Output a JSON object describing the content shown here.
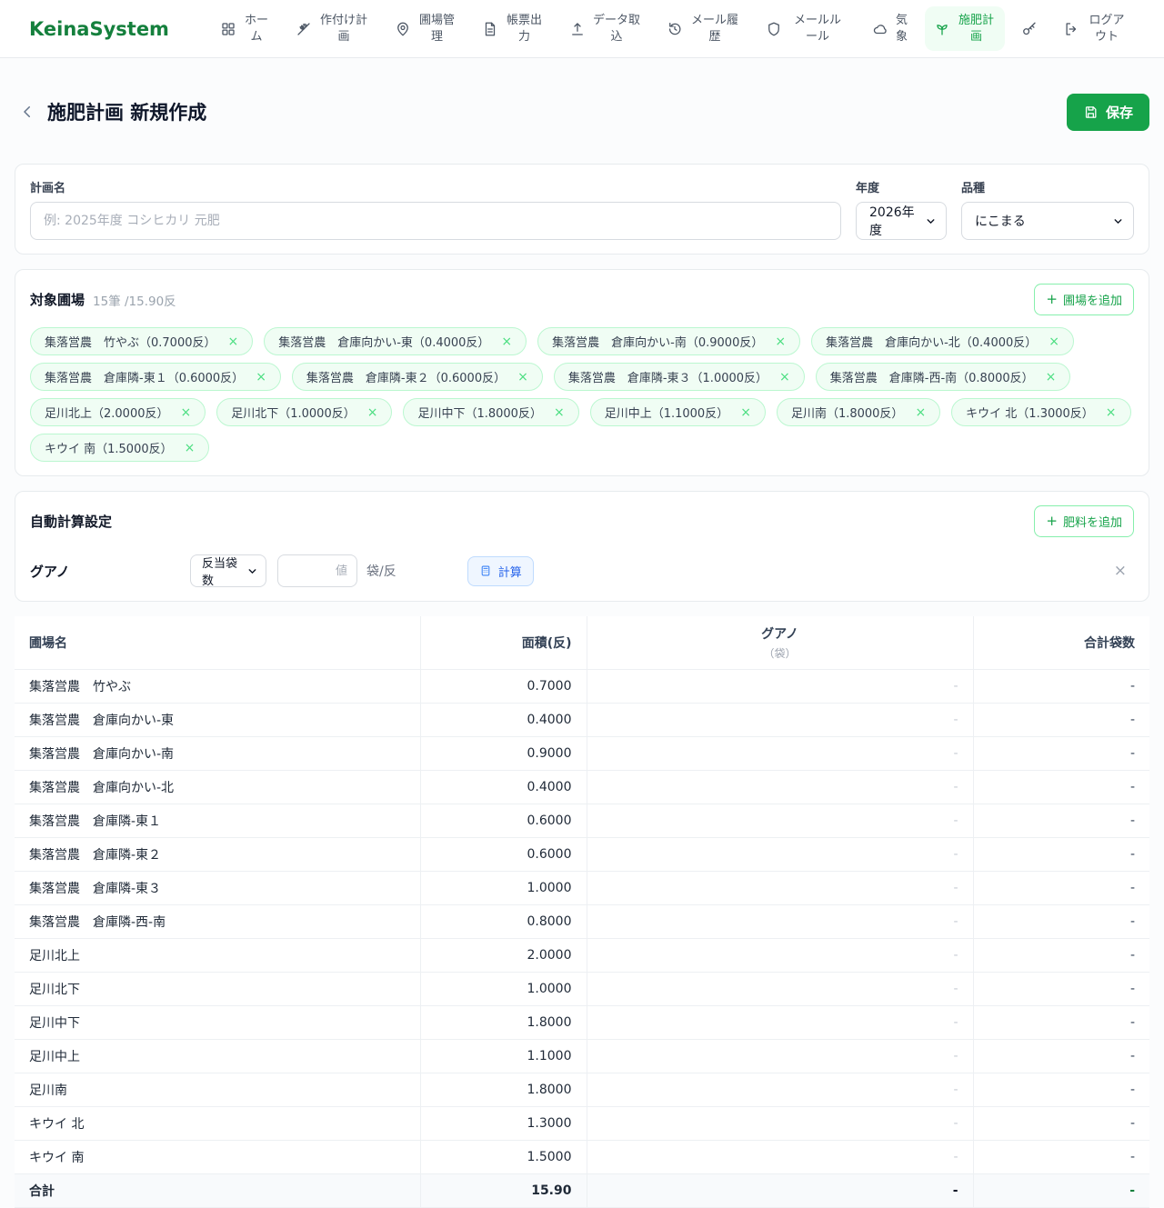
{
  "brand": "KeinaSystem",
  "colors": {
    "brand_green": "#15803d",
    "active_green": "#16a34a",
    "active_bg": "#f0fdf4",
    "tag_border": "#bbf7d0",
    "calc_blue": "#2563eb",
    "calc_bg": "#eff6ff"
  },
  "icon_map": {
    "close": "×",
    "plus": "+"
  },
  "nav": {
    "items": [
      {
        "name": "home",
        "icon": "grid-icon",
        "label": "ホーム",
        "active": false
      },
      {
        "name": "planting-plan",
        "icon": "wheat-icon",
        "label": "作付け計画",
        "active": false
      },
      {
        "name": "field-management",
        "icon": "map-pin-icon",
        "label": "圃場管理",
        "active": false
      },
      {
        "name": "report-output",
        "icon": "document-icon",
        "label": "帳票出力",
        "active": false
      },
      {
        "name": "data-import",
        "icon": "upload-icon",
        "label": "データ取込",
        "active": false
      },
      {
        "name": "mail-history",
        "icon": "history-icon",
        "label": "メール履歴",
        "active": false
      },
      {
        "name": "mail-rules",
        "icon": "shield-icon",
        "label": "メールルール",
        "active": false
      },
      {
        "name": "weather",
        "icon": "cloud-icon",
        "label": "気象",
        "active": false
      },
      {
        "name": "fertilization-plan",
        "icon": "sprout-icon",
        "label": "施肥計画",
        "active": true
      }
    ],
    "logout_label": "ログアウト"
  },
  "header": {
    "title": "施肥計画 新規作成",
    "save_label": "保存"
  },
  "plan_form": {
    "name_label": "計画名",
    "name_placeholder": "例: 2025年度 コシヒカリ 元肥",
    "year_label": "年度",
    "year_value": "2026年度",
    "variety_label": "品種",
    "variety_value": "にこまる"
  },
  "fields_section": {
    "title": "対象圃場",
    "summary": "15筆 /15.90反",
    "add_button": "圃場を追加",
    "tags": [
      {
        "label": "集落営農　竹やぶ（0.7000反）"
      },
      {
        "label": "集落営農　倉庫向かい-東（0.4000反）"
      },
      {
        "label": "集落営農　倉庫向かい-南（0.9000反）"
      },
      {
        "label": "集落営農　倉庫向かい-北（0.4000反）"
      },
      {
        "label": "集落営農　倉庫隣-東１（0.6000反）"
      },
      {
        "label": "集落営農　倉庫隣-東２（0.6000反）"
      },
      {
        "label": "集落営農　倉庫隣-東３（1.0000反）"
      },
      {
        "label": "集落営農　倉庫隣-西-南（0.8000反）"
      },
      {
        "label": "足川北上（2.0000反）"
      },
      {
        "label": "足川北下（1.0000反）"
      },
      {
        "label": "足川中下（1.8000反）"
      },
      {
        "label": "足川中上（1.1000反）"
      },
      {
        "label": "足川南（1.8000反）"
      },
      {
        "label": "キウイ 北（1.3000反）"
      },
      {
        "label": "キウイ 南（1.5000反）"
      }
    ]
  },
  "calc_section": {
    "title": "自動計算設定",
    "add_button": "肥料を追加",
    "fertilizer_name": "グアノ",
    "mode_value": "反当袋数",
    "value_placeholder": "値",
    "unit": "袋/反",
    "calc_label": "計算"
  },
  "table": {
    "headers": {
      "field": "圃場名",
      "area": "面積(反)",
      "fertilizer": "グアノ",
      "fertilizer_unit": "（袋）",
      "total": "合計袋数"
    },
    "rows": [
      {
        "name": "集落営農　竹やぶ",
        "area": "0.7000",
        "fert": "-",
        "total": "-"
      },
      {
        "name": "集落営農　倉庫向かい-東",
        "area": "0.4000",
        "fert": "-",
        "total": "-"
      },
      {
        "name": "集落営農　倉庫向かい-南",
        "area": "0.9000",
        "fert": "-",
        "total": "-"
      },
      {
        "name": "集落営農　倉庫向かい-北",
        "area": "0.4000",
        "fert": "-",
        "total": "-"
      },
      {
        "name": "集落営農　倉庫隣-東１",
        "area": "0.6000",
        "fert": "-",
        "total": "-"
      },
      {
        "name": "集落営農　倉庫隣-東２",
        "area": "0.6000",
        "fert": "-",
        "total": "-"
      },
      {
        "name": "集落営農　倉庫隣-東３",
        "area": "1.0000",
        "fert": "-",
        "total": "-"
      },
      {
        "name": "集落営農　倉庫隣-西-南",
        "area": "0.8000",
        "fert": "-",
        "total": "-"
      },
      {
        "name": "足川北上",
        "area": "2.0000",
        "fert": "-",
        "total": "-"
      },
      {
        "name": "足川北下",
        "area": "1.0000",
        "fert": "-",
        "total": "-"
      },
      {
        "name": "足川中下",
        "area": "1.8000",
        "fert": "-",
        "total": "-"
      },
      {
        "name": "足川中上",
        "area": "1.1000",
        "fert": "-",
        "total": "-"
      },
      {
        "name": "足川南",
        "area": "1.8000",
        "fert": "-",
        "total": "-"
      },
      {
        "name": "キウイ 北",
        "area": "1.3000",
        "fert": "-",
        "total": "-"
      },
      {
        "name": "キウイ 南",
        "area": "1.5000",
        "fert": "-",
        "total": "-"
      }
    ],
    "total_row": {
      "label": "合計",
      "area": "15.90",
      "fert": "-",
      "total": "-"
    }
  }
}
